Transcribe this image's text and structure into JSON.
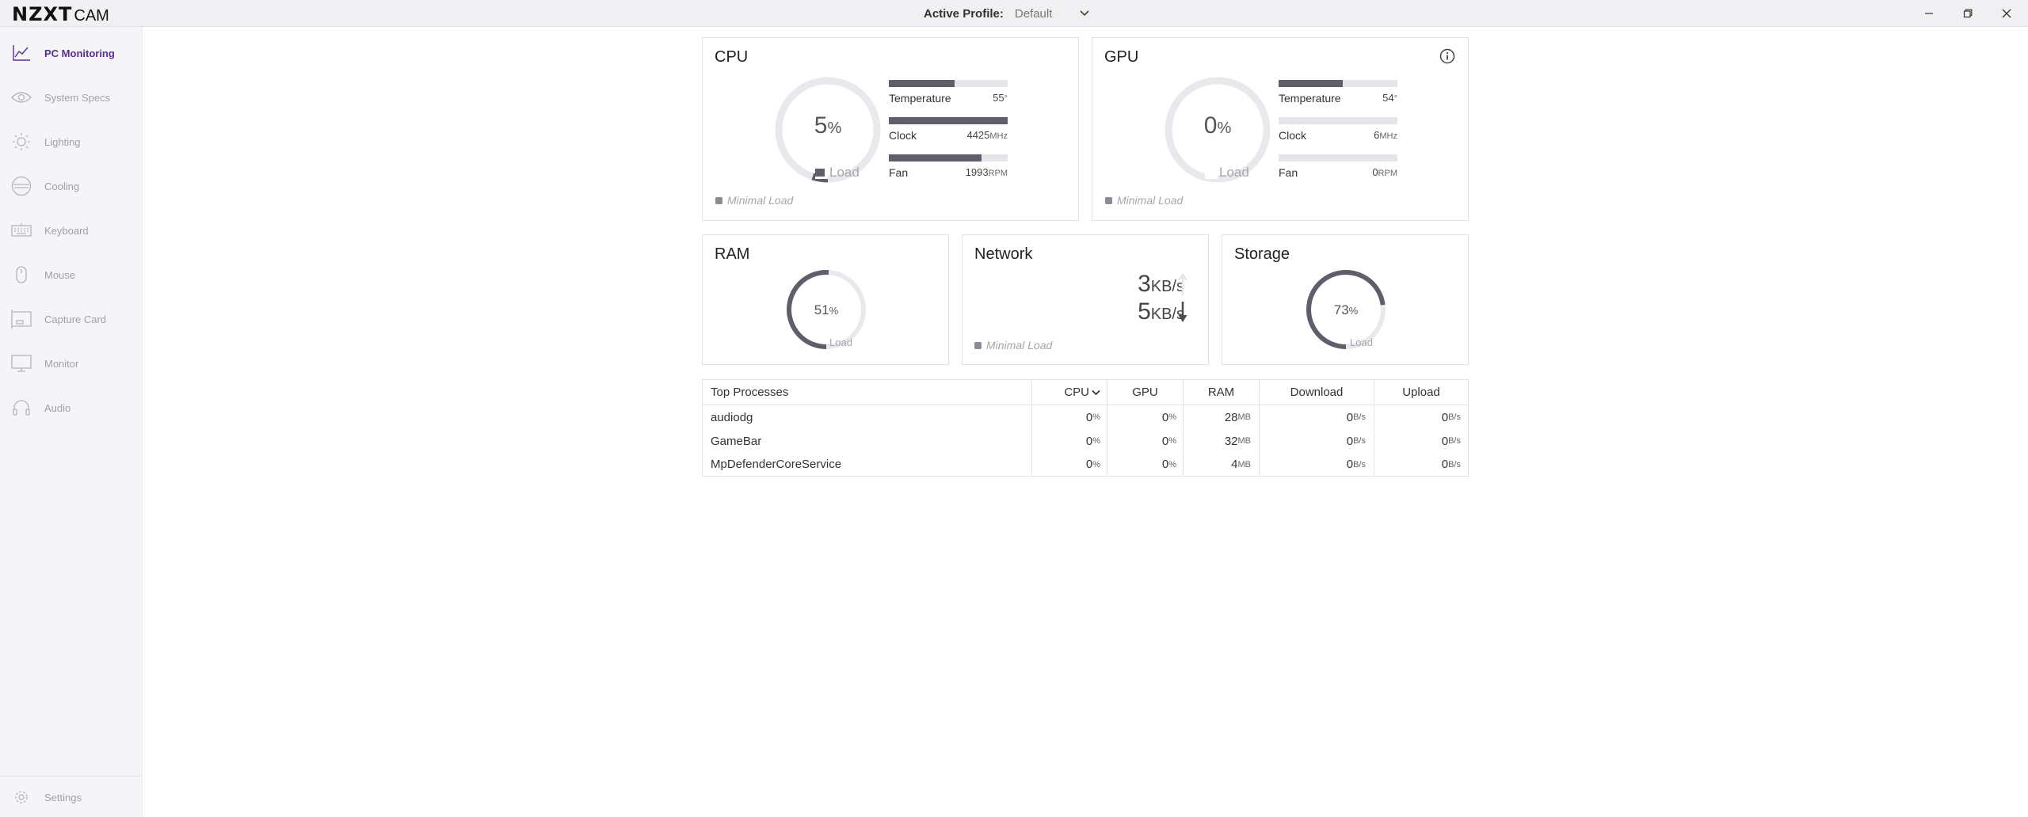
{
  "app": {
    "brand": "NZXT",
    "name": "CAM"
  },
  "profile": {
    "label": "Active Profile:",
    "value": "Default"
  },
  "sidebar": {
    "items": [
      {
        "label": "PC Monitoring",
        "icon": "chart-line-icon",
        "active": true
      },
      {
        "label": "System Specs",
        "icon": "eye-icon"
      },
      {
        "label": "Lighting",
        "icon": "sun-icon"
      },
      {
        "label": "Cooling",
        "icon": "fan-icon"
      },
      {
        "label": "Keyboard",
        "icon": "keyboard-icon"
      },
      {
        "label": "Mouse",
        "icon": "mouse-icon"
      },
      {
        "label": "Capture Card",
        "icon": "capture-card-icon"
      },
      {
        "label": "Monitor",
        "icon": "monitor-icon"
      },
      {
        "label": "Audio",
        "icon": "headphones-icon"
      }
    ],
    "settings": "Settings"
  },
  "cpu": {
    "title": "CPU",
    "load_value": "5",
    "load_unit": "%",
    "load_label": "Load",
    "load_fraction": 0.05,
    "note": "Minimal Load",
    "metrics": [
      {
        "label": "Temperature",
        "value": "55",
        "unit": "°",
        "fill": 0.55
      },
      {
        "label": "Clock",
        "value": "4425",
        "unit": "MHz",
        "fill": 1.0
      },
      {
        "label": "Fan",
        "value": "1993",
        "unit": "RPM",
        "fill": 0.78
      }
    ]
  },
  "gpu": {
    "title": "GPU",
    "load_value": "0",
    "load_unit": "%",
    "load_label": "Load",
    "load_fraction": 0.0,
    "note": "Minimal Load",
    "metrics": [
      {
        "label": "Temperature",
        "value": "54",
        "unit": "°",
        "fill": 0.54
      },
      {
        "label": "Clock",
        "value": "6",
        "unit": "MHz",
        "fill": 0.0
      },
      {
        "label": "Fan",
        "value": "0",
        "unit": "RPM",
        "fill": 0.0
      }
    ]
  },
  "ram": {
    "title": "RAM",
    "value": "51",
    "unit": "%",
    "label": "Load",
    "fraction": 0.51
  },
  "network": {
    "title": "Network",
    "up_value": "3",
    "up_unit": "KB/s",
    "down_value": "5",
    "down_unit": "KB/s",
    "note": "Minimal Load"
  },
  "storage": {
    "title": "Storage",
    "value": "73",
    "unit": "%",
    "label": "Load",
    "fraction": 0.73
  },
  "processes": {
    "headers": [
      "Top Processes",
      "CPU",
      "GPU",
      "RAM",
      "Download",
      "Upload"
    ],
    "rows": [
      {
        "name": "audiodg",
        "cpu": "0",
        "gpu": "0",
        "ram": "28",
        "ram_unit": "MB",
        "down": "0",
        "up": "0"
      },
      {
        "name": "GameBar",
        "cpu": "0",
        "gpu": "0",
        "ram": "32",
        "ram_unit": "MB",
        "down": "0",
        "up": "0"
      },
      {
        "name": "MpDefenderCoreService",
        "cpu": "0",
        "gpu": "0",
        "ram": "4",
        "ram_unit": "MB",
        "down": "0",
        "up": "0"
      }
    ],
    "pct_unit": "%",
    "rate_unit": "B/s"
  },
  "colors": {
    "accent": "#5c2d91",
    "bar_fill": "#5f5f6c",
    "bar_track": "#e6e6ea",
    "gauge_track": "#e9e9ed"
  }
}
